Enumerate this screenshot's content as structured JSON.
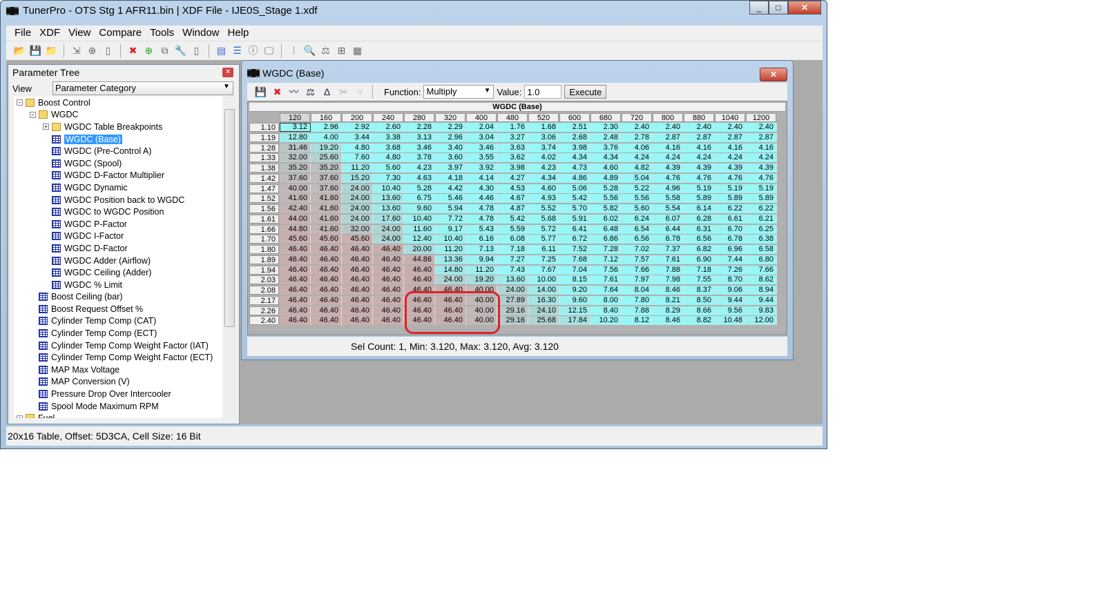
{
  "app": {
    "title": "TunerPro - OTS Stg 1 AFR11.bin | XDF File - IJE0S_Stage 1.xdf",
    "menu": [
      "File",
      "XDF",
      "View",
      "Compare",
      "Tools",
      "Window",
      "Help"
    ]
  },
  "toolbar_icons": [
    "open-icon",
    "save-icon",
    "open-folder-icon",
    "import-icon",
    "add-doc-icon",
    "new-doc-icon",
    "delete-icon",
    "add-icon",
    "copy-icon",
    "wrench-icon",
    "blank-doc-icon",
    "layout-icon",
    "split-icon",
    "info-window-icon",
    "monitor-icon",
    "binary-icon",
    "search-icon",
    "compare-scale-icon",
    "hierarchy-icon",
    "calculator-icon"
  ],
  "tree": {
    "title": "Parameter Tree",
    "view_label": "View",
    "view_value": "Parameter Category",
    "items": [
      {
        "label": "Boost Control",
        "level": 0,
        "type": "folder",
        "exp": "-"
      },
      {
        "label": "WGDC",
        "level": 1,
        "type": "folder",
        "exp": "-"
      },
      {
        "label": "WGDC Table Breakpoints",
        "level": 2,
        "type": "folder",
        "exp": "+"
      },
      {
        "label": "WGDC (Base)",
        "level": 2,
        "type": "table",
        "selected": true
      },
      {
        "label": "WGDC (Pre-Control A)",
        "level": 2,
        "type": "table"
      },
      {
        "label": "WGDC (Spool)",
        "level": 2,
        "type": "table"
      },
      {
        "label": "WGDC D-Factor Multiplier",
        "level": 2,
        "type": "table"
      },
      {
        "label": "WGDC Dynamic",
        "level": 2,
        "type": "table"
      },
      {
        "label": "WGDC Position back to WGDC",
        "level": 2,
        "type": "table"
      },
      {
        "label": "WGDC to WGDC Position",
        "level": 2,
        "type": "table"
      },
      {
        "label": "WGDC P-Factor",
        "level": 2,
        "type": "table"
      },
      {
        "label": "WGDC I-Factor",
        "level": 2,
        "type": "table"
      },
      {
        "label": "WGDC D-Factor",
        "level": 2,
        "type": "table"
      },
      {
        "label": "WGDC Adder (Airflow)",
        "level": 2,
        "type": "table"
      },
      {
        "label": "WGDC Ceiling (Adder)",
        "level": 2,
        "type": "table"
      },
      {
        "label": "WGDC % Limit",
        "level": 2,
        "type": "table"
      },
      {
        "label": "Boost Ceiling (bar)",
        "level": 1,
        "type": "table"
      },
      {
        "label": "Boost Request Offset %",
        "level": 1,
        "type": "table"
      },
      {
        "label": "Cylinder Temp Comp (CAT)",
        "level": 1,
        "type": "table"
      },
      {
        "label": "Cylinder Temp Comp (ECT)",
        "level": 1,
        "type": "table"
      },
      {
        "label": "Cylinder Temp Comp Weight Factor (IAT)",
        "level": 1,
        "type": "table"
      },
      {
        "label": "Cylinder Temp Comp Weight Factor (ECT)",
        "level": 1,
        "type": "table"
      },
      {
        "label": "MAP Max Voltage",
        "level": 1,
        "type": "table"
      },
      {
        "label": "MAP Conversion (V)",
        "level": 1,
        "type": "table"
      },
      {
        "label": "Pressure Drop Over Intercooler",
        "level": 1,
        "type": "table"
      },
      {
        "label": "Spool Mode Maximum RPM",
        "level": 1,
        "type": "table"
      },
      {
        "label": "Fuel",
        "level": 0,
        "type": "folder",
        "exp": "+"
      }
    ]
  },
  "editor": {
    "title": "WGDC (Base)",
    "function_label": "Function:",
    "function_value": "Multiply",
    "value_label": "Value:",
    "value": "1.0",
    "execute": "Execute",
    "tool_icons": [
      "save-icon",
      "delete-icon",
      "graph-icon",
      "compare-icon",
      "delta-icon",
      "cut-icon",
      "merge-icon"
    ],
    "status": "Sel Count: 1, Min: 3.120, Max: 3.120, Avg: 3.120",
    "table": {
      "title": "WGDC (Base)",
      "cols": [
        "120",
        "160",
        "200",
        "240",
        "280",
        "320",
        "400",
        "480",
        "520",
        "600",
        "680",
        "720",
        "800",
        "880",
        "1040",
        "1200"
      ],
      "rows": [
        "1.10",
        "1.19",
        "1.28",
        "1.33",
        "1.38",
        "1.42",
        "1.47",
        "1.52",
        "1.56",
        "1.61",
        "1.66",
        "1.70",
        "1.80",
        "1.89",
        "1.94",
        "2.03",
        "2.08",
        "2.17",
        "2.26",
        "2.40"
      ],
      "values": [
        [
          "3.12",
          "2.96",
          "2.92",
          "2.60",
          "2.28",
          "2.29",
          "2.04",
          "1.76",
          "1.68",
          "2.51",
          "2.30",
          "2.40",
          "2.40",
          "2.40",
          "2.40",
          "2.40"
        ],
        [
          "12.80",
          "4.00",
          "3.44",
          "3.38",
          "3.13",
          "2.96",
          "3.04",
          "3.27",
          "3.06",
          "2.68",
          "2.48",
          "2.78",
          "2.87",
          "2.87",
          "2.87",
          "2.87"
        ],
        [
          "31.46",
          "19.20",
          "4.80",
          "3.68",
          "3.46",
          "3.40",
          "3.46",
          "3.63",
          "3.74",
          "3.98",
          "3.76",
          "4.06",
          "4.16",
          "4.16",
          "4.16",
          "4.16"
        ],
        [
          "32.00",
          "25.60",
          "7.60",
          "4.80",
          "3.78",
          "3.60",
          "3.55",
          "3.62",
          "4.02",
          "4.34",
          "4.34",
          "4.24",
          "4.24",
          "4.24",
          "4.24",
          "4.24"
        ],
        [
          "35.20",
          "35.20",
          "11.20",
          "5.60",
          "4.23",
          "3.97",
          "3.92",
          "3.98",
          "4.23",
          "4.73",
          "4.60",
          "4.82",
          "4.39",
          "4.39",
          "4.39",
          "4.39"
        ],
        [
          "37.60",
          "37.60",
          "15.20",
          "7.30",
          "4.63",
          "4.18",
          "4.14",
          "4.27",
          "4.34",
          "4.86",
          "4.89",
          "5.04",
          "4.76",
          "4.76",
          "4.76",
          "4.76"
        ],
        [
          "40.00",
          "37.60",
          "24.00",
          "10.40",
          "5.28",
          "4.42",
          "4.30",
          "4.53",
          "4.60",
          "5.06",
          "5.28",
          "5.22",
          "4.96",
          "5.19",
          "5.19",
          "5.19"
        ],
        [
          "41.60",
          "41.60",
          "24.00",
          "13.60",
          "6.75",
          "5.46",
          "4.46",
          "4.67",
          "4.93",
          "5.42",
          "5.56",
          "5.56",
          "5.58",
          "5.89",
          "5.89",
          "5.89"
        ],
        [
          "42.40",
          "41.60",
          "24.00",
          "13.60",
          "9.60",
          "5.94",
          "4.78",
          "4.87",
          "5.52",
          "5.70",
          "5.82",
          "5.60",
          "5.54",
          "6.14",
          "6.22",
          "6.22"
        ],
        [
          "44.00",
          "41.60",
          "24.00",
          "17.60",
          "10.40",
          "7.72",
          "4.78",
          "5.42",
          "5.68",
          "5.91",
          "6.02",
          "6.24",
          "6.07",
          "6.28",
          "6.61",
          "6.21"
        ],
        [
          "44.80",
          "41.60",
          "32.00",
          "24.00",
          "11.60",
          "9.17",
          "5.43",
          "5.59",
          "5.72",
          "6.41",
          "6.48",
          "6.54",
          "6.44",
          "6.31",
          "6.70",
          "6.25"
        ],
        [
          "45.60",
          "45.60",
          "45.60",
          "24.00",
          "12.40",
          "10.40",
          "6.16",
          "6.08",
          "5.77",
          "6.72",
          "6.86",
          "6.56",
          "6.78",
          "6.56",
          "6.78",
          "6.38"
        ],
        [
          "46.40",
          "46.40",
          "46.40",
          "46.40",
          "20.00",
          "11.20",
          "7.13",
          "7.18",
          "6.11",
          "7.52",
          "7.28",
          "7.02",
          "7.37",
          "6.82",
          "6.96",
          "6.58"
        ],
        [
          "46.40",
          "46.40",
          "46.40",
          "46.40",
          "44.86",
          "13.36",
          "9.94",
          "7.27",
          "7.25",
          "7.68",
          "7.12",
          "7.57",
          "7.61",
          "6.90",
          "7.44",
          "6.80"
        ],
        [
          "46.40",
          "46.40",
          "46.40",
          "46.40",
          "46.40",
          "14.80",
          "11.20",
          "7.43",
          "7.67",
          "7.04",
          "7.56",
          "7.66",
          "7.88",
          "7.18",
          "7.26",
          "7.66"
        ],
        [
          "46.40",
          "46.40",
          "46.40",
          "46.40",
          "46.40",
          "24.00",
          "19.20",
          "13.60",
          "10.00",
          "8.15",
          "7.61",
          "7.97",
          "7.98",
          "7.55",
          "8.70",
          "8.62"
        ],
        [
          "46.40",
          "46.40",
          "46.40",
          "46.40",
          "46.40",
          "46.40",
          "40.00",
          "24.00",
          "14.00",
          "9.20",
          "7.64",
          "8.04",
          "8.46",
          "8.37",
          "9.06",
          "8.94"
        ],
        [
          "46.40",
          "46.40",
          "46.40",
          "46.40",
          "46.40",
          "46.40",
          "40.00",
          "27.89",
          "16.30",
          "9.60",
          "8.00",
          "7.80",
          "8.21",
          "8.50",
          "9.44",
          "9.44"
        ],
        [
          "46.40",
          "46.40",
          "46.40",
          "46.40",
          "46.40",
          "46.40",
          "40.00",
          "29.16",
          "24.10",
          "12.15",
          "8.40",
          "7.88",
          "8.29",
          "8.66",
          "9.56",
          "9.83"
        ],
        [
          "46.40",
          "46.40",
          "46.40",
          "46.40",
          "46.40",
          "46.40",
          "40.00",
          "29.16",
          "25.68",
          "17.84",
          "10.20",
          "8.12",
          "8.46",
          "8.82",
          "10.48",
          "12.00"
        ]
      ],
      "selected_cell": {
        "row": "1.10",
        "col": "120"
      },
      "highlight": {
        "rows": [
          "2.17",
          "2.26",
          "2.40"
        ],
        "cols": [
          "280",
          "320",
          "400"
        ],
        "color": "#e0202a"
      }
    }
  },
  "statusbar": "20x16 Table, Offset: 5D3CA,  Cell Size: 16 Bit"
}
